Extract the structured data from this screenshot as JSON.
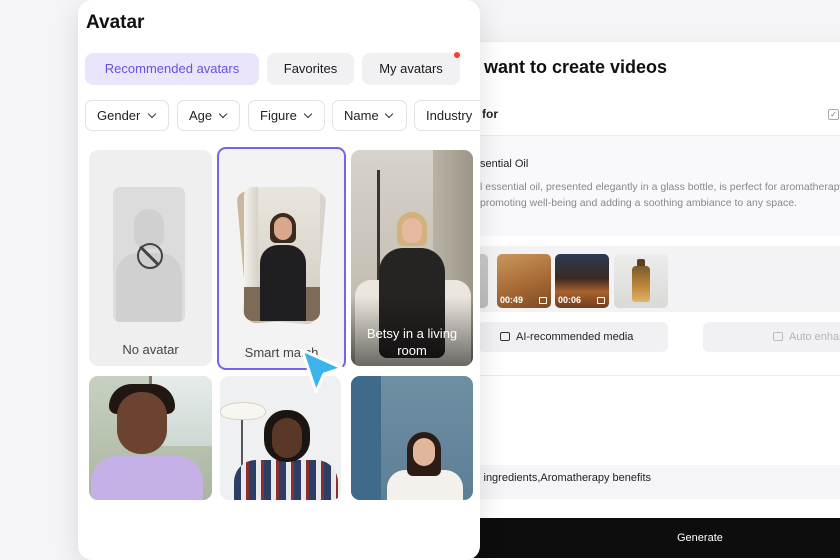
{
  "background_panel": {
    "title": "u want to create videos",
    "use_for_label": "for",
    "checkbox_mark": "✓",
    "product_name": "sential Oil",
    "product_description": "l essential oil, presented elegantly in a glass bottle, is perfect for aromatherapy, promoting well-being and adding a soothing ambiance to any space.",
    "media_thumbnails": [
      {
        "duration": ""
      },
      {
        "duration": "00:49"
      },
      {
        "duration": "00:06"
      },
      {
        "duration": ""
      }
    ],
    "ai_recommended_media_label": "AI-recommended media",
    "auto_enhance_label": "Auto enhance",
    "keywords": "l ingredients,Aromatherapy benefits",
    "generate_label": "Generate"
  },
  "avatar_panel": {
    "title": "Avatar",
    "tabs": [
      {
        "label": "Recommended avatars",
        "active": true
      },
      {
        "label": "Favorites",
        "active": false
      },
      {
        "label": "My avatars",
        "active": false,
        "has_notification": true
      }
    ],
    "filters": [
      "Gender",
      "Age",
      "Figure",
      "Name",
      "Industry"
    ],
    "cards": [
      {
        "label": "No avatar",
        "icon": "no-avatar-icon"
      },
      {
        "label": "Smart match",
        "selected": true
      },
      {
        "label": "Betsy in a living room"
      },
      {
        "label": ""
      },
      {
        "label": ""
      },
      {
        "label": ""
      }
    ]
  },
  "colors": {
    "accent": "#7a62e8",
    "active_tab_bg": "#ebe5fb",
    "notification": "#ff3b30",
    "cursor": "#3ab4ea",
    "generate_bg": "#0d0d0d"
  },
  "cursor_icon": "pointer-cursor-icon"
}
